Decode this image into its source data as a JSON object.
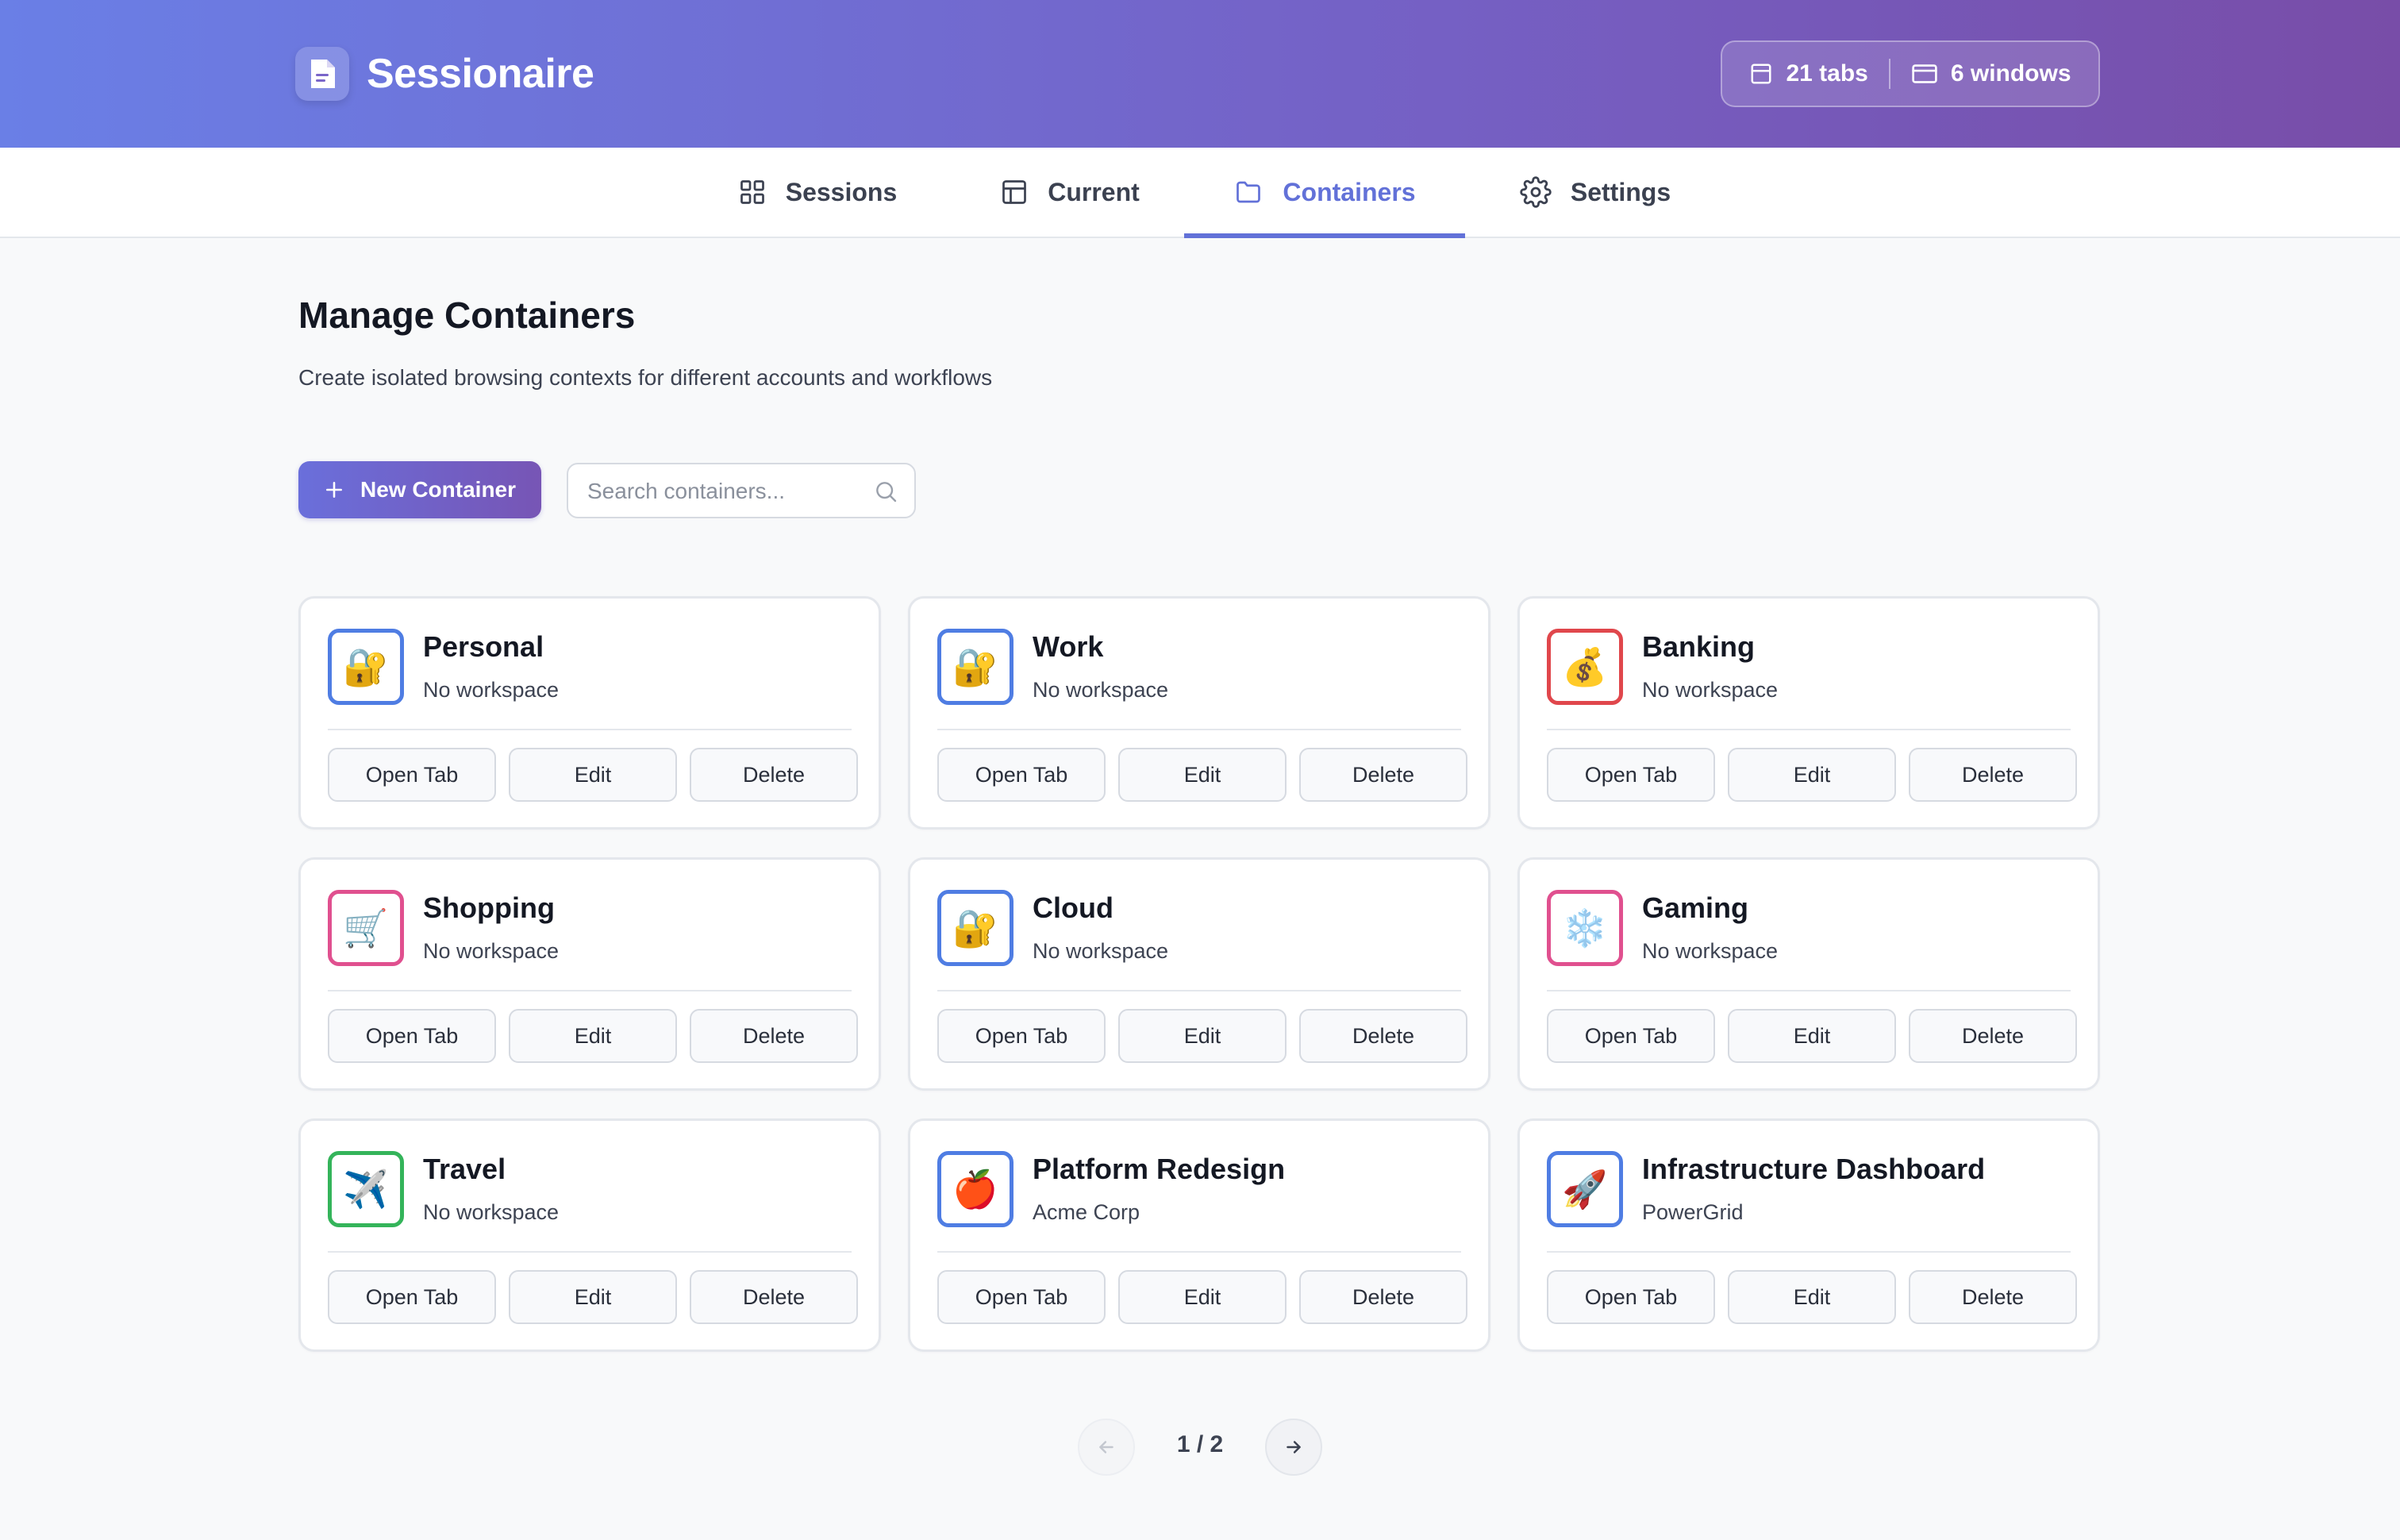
{
  "app": {
    "title": "Sessionaire",
    "stats": {
      "tabs": "21 tabs",
      "windows": "6 windows"
    }
  },
  "nav": {
    "tabs": [
      {
        "label": "Sessions",
        "icon": "grid-icon",
        "active": false
      },
      {
        "label": "Current",
        "icon": "layout-icon",
        "active": false
      },
      {
        "label": "Containers",
        "icon": "folder-icon",
        "active": true
      },
      {
        "label": "Settings",
        "icon": "gear-icon",
        "active": false
      }
    ]
  },
  "page": {
    "title": "Manage Containers",
    "subtitle": "Create isolated browsing contexts for different accounts and workflows",
    "new_button": "New Container",
    "search_placeholder": "Search containers..."
  },
  "containers": [
    {
      "name": "Personal",
      "workspace": "No workspace",
      "icon": "🔐",
      "color": "#4f7de3"
    },
    {
      "name": "Work",
      "workspace": "No workspace",
      "icon": "🔐",
      "color": "#4f7de3"
    },
    {
      "name": "Banking",
      "workspace": "No workspace",
      "icon": "💰",
      "color": "#e0474c"
    },
    {
      "name": "Shopping",
      "workspace": "No workspace",
      "icon": "🛒",
      "color": "#e0508f"
    },
    {
      "name": "Cloud",
      "workspace": "No workspace",
      "icon": "🔐",
      "color": "#4f7de3"
    },
    {
      "name": "Gaming",
      "workspace": "No workspace",
      "icon": "❄️",
      "color": "#e0508f"
    },
    {
      "name": "Travel",
      "workspace": "No workspace",
      "icon": "✈️",
      "color": "#34b45a"
    },
    {
      "name": "Platform Redesign",
      "workspace": "Acme Corp",
      "icon": "🍎",
      "color": "#4f7de3"
    },
    {
      "name": "Infrastructure Dashboard",
      "workspace": "PowerGrid",
      "icon": "🚀",
      "color": "#4f7de3"
    }
  ],
  "card_actions": {
    "open": "Open Tab",
    "edit": "Edit",
    "delete": "Delete"
  },
  "pagination": {
    "text": "1 / 2",
    "current": 1,
    "total": 2
  }
}
